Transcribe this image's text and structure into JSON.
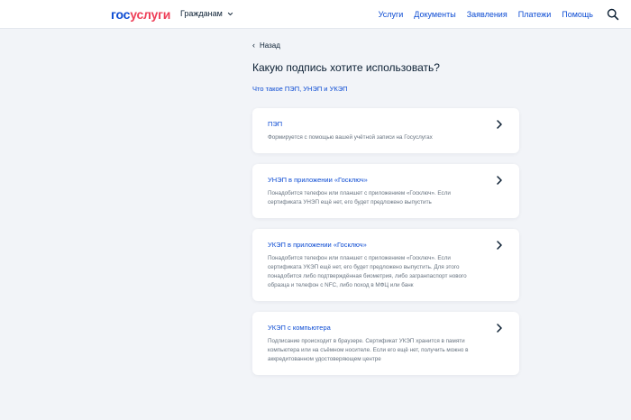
{
  "header": {
    "logo_part1": "гос",
    "logo_part2": "услуги",
    "audience": "Гражданам",
    "nav": [
      "Услуги",
      "Документы",
      "Заявления",
      "Платежи",
      "Помощь"
    ]
  },
  "main": {
    "back": "Назад",
    "title": "Какую подпись хотите использовать?",
    "whatis_link": "Что такое ПЭП, УНЭП и УКЭП"
  },
  "options": [
    {
      "title": "ПЭП",
      "description": "Формируется с помощью вашей учётной записи на Госуслугах"
    },
    {
      "title": "УНЭП в приложении «Госключ»",
      "description": "Понадобится телефон или планшет с приложением «Госключ». Если сертификата УНЭП ещё нет, его будет предложено выпустить"
    },
    {
      "title": "УКЭП в приложении «Госключ»",
      "description": "Понадобится телефон или планшет с приложением «Госключ». Если сертификата УКЭП ещё нет, его будет предложено выпустить. Для этого понадобится либо подтверждённая биометрия, либо загранпаспорт нового образца и телефон с NFC, либо поход в МФЦ или банк"
    },
    {
      "title": "УКЭП с компьютера",
      "description": "Подписание происходит в браузере. Сертификат УКЭП хранится в памяти компьютера или на съёмном носителе. Если его ещё нет, получить можно в аккредитованном удостоверяющем центре"
    }
  ],
  "colors": {
    "brand_blue": "#0d4cd3",
    "brand_red": "#ee3f58",
    "text_dark": "#0b1f33",
    "text_muted": "#66727f",
    "background": "#f2f4f8"
  },
  "icons": {
    "audience_dropdown": "chevron-down-icon",
    "search": "search-icon",
    "back": "chevron-left-icon",
    "card_arrow": "chevron-right-icon"
  }
}
